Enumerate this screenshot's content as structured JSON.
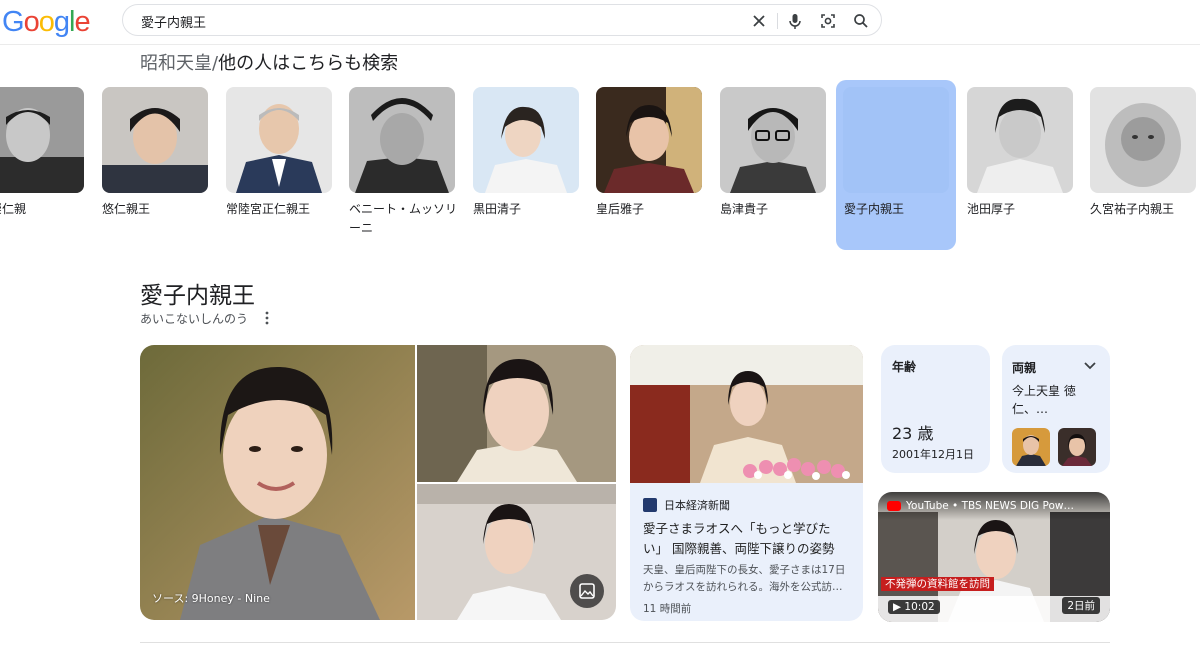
{
  "search": {
    "logo": "Google",
    "query": "愛子内親王"
  },
  "related": {
    "topic": "昭和天皇",
    "separator": "/",
    "heading": "他の人はこちらも検索",
    "people": [
      {
        "name": "宮崇仁親",
        "selected": false
      },
      {
        "name": "悠仁親王",
        "selected": false
      },
      {
        "name": "常陸宮正仁親王",
        "selected": false
      },
      {
        "name": "ベニート・ムッソリーニ",
        "selected": false
      },
      {
        "name": "黒田清子",
        "selected": false
      },
      {
        "name": "皇后雅子",
        "selected": false
      },
      {
        "name": "島津貴子",
        "selected": false
      },
      {
        "name": "愛子内親王",
        "selected": true
      },
      {
        "name": "池田厚子",
        "selected": false
      },
      {
        "name": "久宮祐子内親王",
        "selected": false
      }
    ]
  },
  "entity": {
    "title": "愛子内親王",
    "reading": "あいこないしんのう"
  },
  "images": {
    "source": "ソース: 9Honey - Nine"
  },
  "news": {
    "publisher": "日本経済新聞",
    "headline": "愛子さまラオスへ「もっと学びたい」 国際親善、両陛下譲りの姿勢",
    "snippet": "天皇、皇后両陛下の長女、愛子さまは17日からラオスを訪れられる。海外を公式訪…",
    "time": "11 時間前"
  },
  "age": {
    "label": "年齢",
    "value": "23 歳",
    "birthdate": "2001年12月1日"
  },
  "parents": {
    "label": "両親",
    "names": "今上天皇 徳仁、…"
  },
  "video": {
    "title": "YouTube • TBS NEWS DIG Pow…",
    "duration": "10:02",
    "age": "2日前",
    "caption": "不発弾の資料館を訪問"
  },
  "colors": {
    "selected_card": "#a8c7fa",
    "panel_bg": "#eaf0fb",
    "google_blue": "#4285f4",
    "google_red": "#ea4335",
    "google_yellow": "#fbbc05",
    "google_green": "#34a853"
  }
}
